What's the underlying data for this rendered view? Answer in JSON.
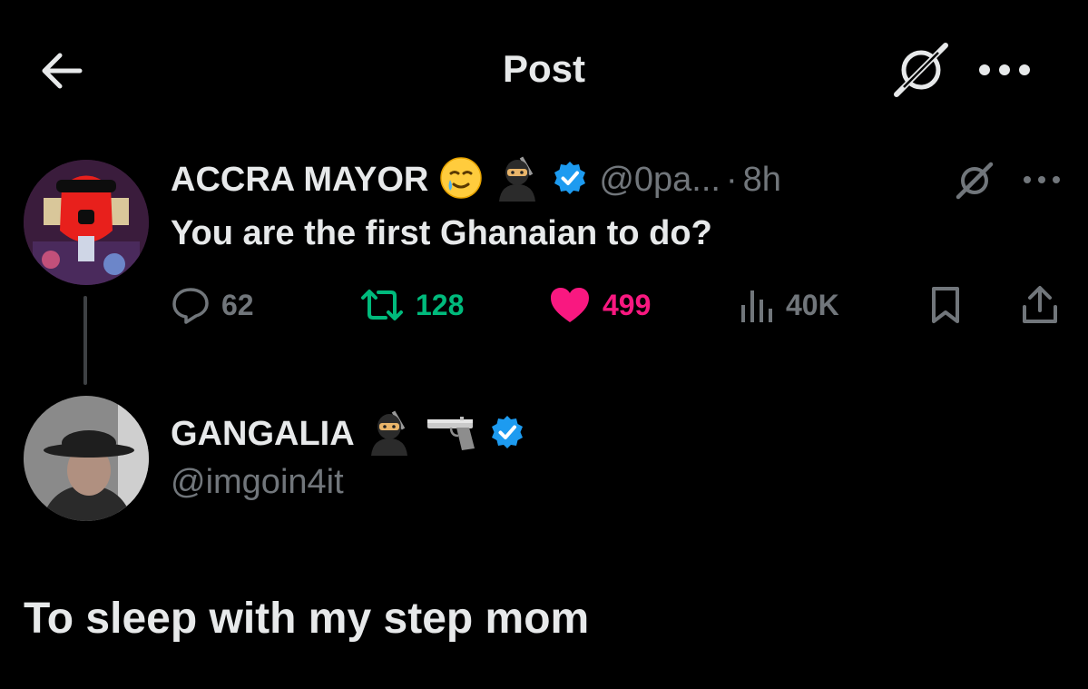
{
  "header": {
    "title": "Post",
    "back_icon": "arrow-left-icon",
    "grok_icon": "grok-icon",
    "more_icon": "more-horizontal-icon"
  },
  "original_post": {
    "display_name": "ACCRA MAYOR",
    "emojis": [
      "smiling-face-with-tear-emoji",
      "ninja-emoji"
    ],
    "verified": true,
    "handle": "@0pa...",
    "separator": "·",
    "time": "8h",
    "text": "You are the first Ghanaian to do?",
    "stats": {
      "replies": "62",
      "reposts": "128",
      "likes": "499",
      "views": "40K"
    },
    "liked": true
  },
  "reply_post": {
    "display_name": "GANGALIA",
    "emojis": [
      "ninja-emoji",
      "pistol-emoji"
    ],
    "verified": true,
    "handle": "@imgoin4it",
    "text": "To sleep with my step mom"
  },
  "colors": {
    "background": "#000000",
    "text_primary": "#e7e9ea",
    "text_secondary": "#71767b",
    "verified_blue": "#1d9bf0",
    "repost_green": "#00ba7c",
    "like_pink": "#f91880"
  }
}
